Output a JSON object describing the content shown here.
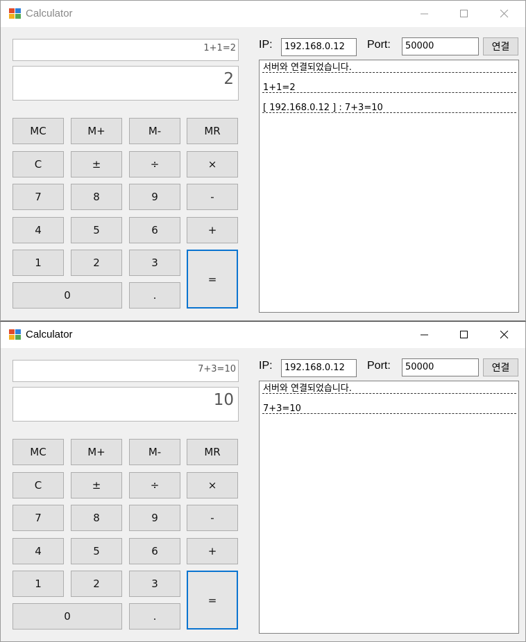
{
  "windows": [
    {
      "title": "Calculator",
      "expression": "1+1=2",
      "result": "2",
      "ip_label": "IP:",
      "ip_value": "192.168.0.12",
      "port_label": "Port:",
      "port_value": "50000",
      "connect_label": "연결",
      "log": [
        "서버와 연결되었습니다.",
        "1+1=2",
        "[ 192.168.0.12 ] : 7+3=10"
      ]
    },
    {
      "title": "Calculator",
      "expression": "7+3=10",
      "result": "10",
      "ip_label": "IP:",
      "ip_value": "192.168.0.12",
      "port_label": "Port:",
      "port_value": "50000",
      "connect_label": "연결",
      "log": [
        "서버와 연결되었습니다.",
        "7+3=10"
      ]
    }
  ],
  "keypad": {
    "mc": "MC",
    "mplus": "M+",
    "mminus": "M-",
    "mr": "MR",
    "clear": "C",
    "negate": "±",
    "divide": "÷",
    "multiply": "×",
    "d7": "7",
    "d8": "8",
    "d9": "9",
    "minus": "-",
    "d4": "4",
    "d5": "5",
    "d6": "6",
    "plus": "+",
    "d1": "1",
    "d2": "2",
    "d3": "3",
    "equals": "=",
    "d0": "0",
    "dot": "."
  },
  "colors": {
    "equals_border": "#0a74d0",
    "window_bg": "#f0f0f0",
    "button_bg": "#e1e1e1"
  }
}
